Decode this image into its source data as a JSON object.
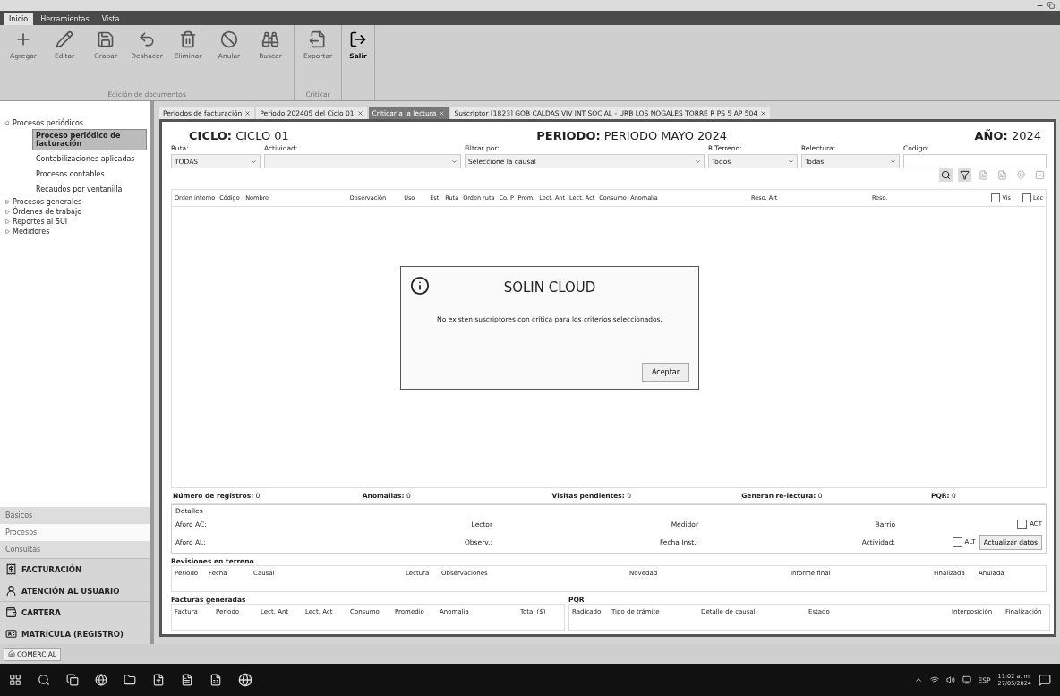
{
  "menu_tabs": [
    {
      "label": "Inicio",
      "selected": true
    },
    {
      "label": "Herramientas",
      "selected": false
    },
    {
      "label": "Vista",
      "selected": false
    }
  ],
  "ribbon": {
    "groups": [
      {
        "label": "Edición de documentos",
        "buttons": [
          {
            "label": "Agregar",
            "enabled": false
          },
          {
            "label": "Editar",
            "enabled": false
          },
          {
            "label": "Grabar",
            "enabled": false
          },
          {
            "label": "Deshacer",
            "enabled": false
          },
          {
            "label": "Eliminar",
            "enabled": false
          },
          {
            "label": "Anular",
            "enabled": false
          },
          {
            "label": "Buscar",
            "enabled": false
          }
        ]
      },
      {
        "label": "Criticar",
        "buttons": [
          {
            "label": "Exportar",
            "enabled": false
          }
        ]
      },
      {
        "buttons": [
          {
            "label": "Salir",
            "enabled": true
          }
        ]
      }
    ]
  },
  "sidebar": {
    "tree": [
      {
        "label": "Procesos periódicos",
        "expanded": true,
        "children": [
          {
            "label": "Proceso periódico de facturación",
            "selected": true
          },
          {
            "label": "Contabilizaciones aplicadas",
            "selected": false
          },
          {
            "label": "Procesos contables",
            "selected": false
          },
          {
            "label": "Recaudos por ventanilla",
            "selected": false
          }
        ]
      },
      {
        "label": "Procesos generales",
        "expanded": false
      },
      {
        "label": "Órdenes de trabajo",
        "expanded": false
      },
      {
        "label": "Reportes al SUI",
        "expanded": false
      },
      {
        "label": "Medidores",
        "expanded": false
      }
    ],
    "sections": [
      {
        "label": "Basicos",
        "selected": false
      },
      {
        "label": "Procesos",
        "selected": true
      },
      {
        "label": "Consultas",
        "selected": false
      }
    ],
    "modules": [
      "FACTURACIÓN",
      "ATENCIÓN AL USUARIO",
      "CARTERA",
      "MATRÍCULA (REGISTRO)"
    ],
    "footer_tab": "COMERCIAL"
  },
  "doc_tabs": [
    {
      "label": "Periodos de facturación",
      "selected": false
    },
    {
      "label": "Periodo 202405 del Ciclo 01",
      "selected": false
    },
    {
      "label": "Criticar a la lectura",
      "selected": true
    },
    {
      "label": "Suscriptor [1823] GOB CALDAS VIV INT SOCIAL - URB LOS NOGALES TORRE R PS 5 AP 504",
      "selected": false
    }
  ],
  "header": [
    {
      "label": "CICLO:",
      "value": "CICLO 01"
    },
    {
      "label": "PERIODO:",
      "value": "PERIODO MAYO 2024"
    },
    {
      "label": "AÑO:",
      "value": "2024"
    }
  ],
  "filters": [
    {
      "label": "Ruta:",
      "kind": "select",
      "value": "TODAS"
    },
    {
      "label": "Actividad:",
      "kind": "select"
    },
    {
      "label": "Filtrar por:",
      "kind": "select",
      "value": "Seleccione la causal"
    },
    {
      "label": "R.Terreno:",
      "kind": "select",
      "value": "Todos"
    },
    {
      "label": "Relectura:",
      "kind": "select",
      "value": "Todas"
    },
    {
      "label": "Codigo:",
      "kind": "input"
    }
  ],
  "tools": [
    {
      "enabled": true
    },
    {
      "enabled": true
    },
    {
      "enabled": false
    },
    {
      "enabled": false
    },
    {
      "enabled": false
    },
    {
      "enabled": false
    }
  ],
  "grid": {
    "columns": [
      "Orden interno",
      "Código",
      "Nombre",
      "Observación",
      "Uso",
      "Est.",
      "Ruta",
      "Orden ruta",
      "Co. P",
      "Prom.",
      "Lect. Ant",
      "Lect. Act",
      "Consumo",
      "Anomalía",
      "Reso. Art",
      "Reso."
    ],
    "check_columns": [
      {
        "label": "Vis",
        "checked": false
      },
      {
        "label": "Lec",
        "checked": false
      }
    ]
  },
  "summary": [
    {
      "label": "Número de registros:",
      "value": "0"
    },
    {
      "label": "Anomalias:",
      "value": "0"
    },
    {
      "label": "Visitas pendientes:",
      "value": "0"
    },
    {
      "label": "Generan re-lectura:",
      "value": "0"
    },
    {
      "label": "PQR:",
      "value": "0"
    }
  ],
  "details": {
    "title": "Detalles",
    "rows": [
      [
        "Aforo AC:",
        "Lector",
        "Medidor",
        "Barrio"
      ],
      [
        "Aforo AL:",
        "Observ.:",
        "Fecha Inst.:",
        "Actividad:"
      ]
    ],
    "checks": [
      {
        "label": "ACT",
        "checked": false
      },
      {
        "label": "ALT",
        "checked": false
      }
    ],
    "button": "Actualizar datos"
  },
  "revisiones": {
    "title": "Revisiones en terreno",
    "columns": [
      "Periodo",
      "Fecha",
      "Causal",
      "Lectura",
      "Observaciones",
      "Novedad",
      "Informe final",
      "Finalizada",
      "Anulada"
    ]
  },
  "facturas": {
    "title": "Facturas generadas",
    "columns": [
      "Factura",
      "Periodo",
      "Lect. Ant",
      "Lect. Act",
      "Consumo",
      "Promedio",
      "Anomalia",
      "Total ($)"
    ]
  },
  "pqr": {
    "title": "PQR",
    "columns": [
      "Radicado",
      "Tipo de trámite",
      "Detalle de causal",
      "Estado",
      "Interposición",
      "Finalización"
    ]
  },
  "dialog": {
    "title": "SOLIN CLOUD",
    "message": "No existen suscriptores con crítica para los criterios seleccionados.",
    "button": "Aceptar"
  },
  "taskbar": {
    "language": "ESP",
    "time": "11:02 a. m.",
    "date": "27/05/2024"
  }
}
